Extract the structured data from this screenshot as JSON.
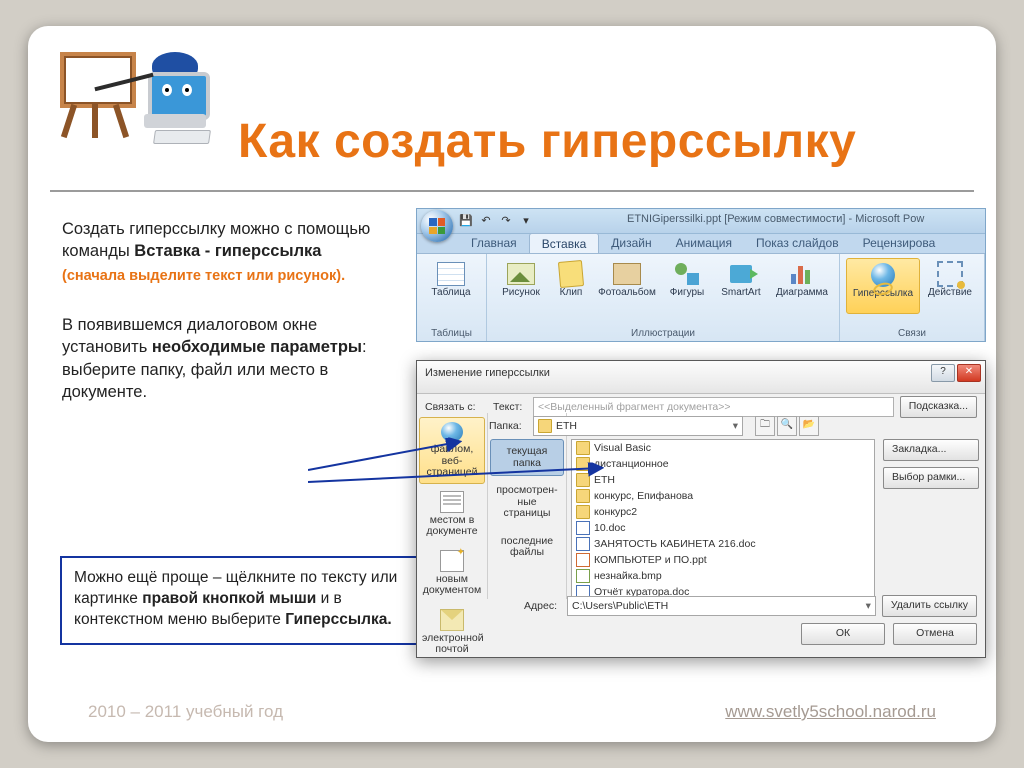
{
  "title": "Как создать гиперссылку",
  "left_text": {
    "para1_pre": "Создать гиперссылку можно с помощью команды ",
    "para1_bold": "Вставка  - гиперссылка",
    "para1_hint": "(сначала выделите текст или рисунок).",
    "para2_pre": "В появившемся диалоговом окне установить ",
    "para2_bold": "необходимые параметры",
    "para2_post": ": выберите папку, файл или место в документе."
  },
  "tip": {
    "pre": "Можно ещё проще – щёлкните по тексту или  картинке ",
    "bold1": "правой кнопкой мыши",
    "mid": " и в контекстном меню выберите ",
    "bold2": "Гиперссылка."
  },
  "footer_left": "2010 – 2011 учебный год",
  "footer_right": "www.svetly5school.narod.ru",
  "ribbon": {
    "doc_title": "ETNIGiperssilki.ppt [Режим совместимости] - Microsoft Pow",
    "tabs": [
      "Главная",
      "Вставка",
      "Дизайн",
      "Анимация",
      "Показ слайдов",
      "Рецензирова"
    ],
    "active_tab": 1,
    "group_tables": {
      "label": "Таблицы",
      "btn_table": "Таблица"
    },
    "group_illustrations": {
      "label": "Иллюстрации",
      "btn_picture": "Рисунок",
      "btn_clip": "Клип",
      "btn_album": "Фотоальбом",
      "btn_shapes": "Фигуры",
      "btn_smartart": "SmartArt",
      "btn_chart": "Диаграмма"
    },
    "group_links": {
      "label": "Связи",
      "btn_hyperlink": "Гиперссылка",
      "btn_action": "Действие"
    }
  },
  "dialog": {
    "title": "Изменение гиперссылки",
    "link_label": "Связать с:",
    "text_label": "Текст:",
    "text_value": "<<Выделенный фрагмент документа>>",
    "hint_btn": "Подсказка...",
    "sidebar": [
      "файлом, веб-страницей",
      "местом в документе",
      "новым документом",
      "электронной почтой"
    ],
    "folder_label": "Папка:",
    "folder_value": "ETH",
    "sub_items": [
      "текущая папка",
      "просмотрен-ные страницы",
      "последние файлы"
    ],
    "files": [
      {
        "icon": "folder",
        "name": "Visual Basic"
      },
      {
        "icon": "folder",
        "name": "дистанционное"
      },
      {
        "icon": "folder",
        "name": "ETH"
      },
      {
        "icon": "folder",
        "name": "конкурс, Епифанова"
      },
      {
        "icon": "folder",
        "name": "конкурс2"
      },
      {
        "icon": "doc",
        "name": "10.doc"
      },
      {
        "icon": "doc",
        "name": "ЗАНЯТОСТЬ КАБИНЕТА   216.doc"
      },
      {
        "icon": "ppt",
        "name": "КОМПЬЮТЕР и ПО.ppt"
      },
      {
        "icon": "bmp",
        "name": "незнайка.bmp"
      },
      {
        "icon": "doc",
        "name": "Отчёт куратора.doc"
      }
    ],
    "bookmark_btn": "Закладка...",
    "frame_btn": "Выбор рамки...",
    "addr_label": "Адрес:",
    "addr_value": "C:\\Users\\Public\\ETH",
    "remove_btn": "Удалить ссылку",
    "ok_btn": "ОК",
    "cancel_btn": "Отмена"
  }
}
